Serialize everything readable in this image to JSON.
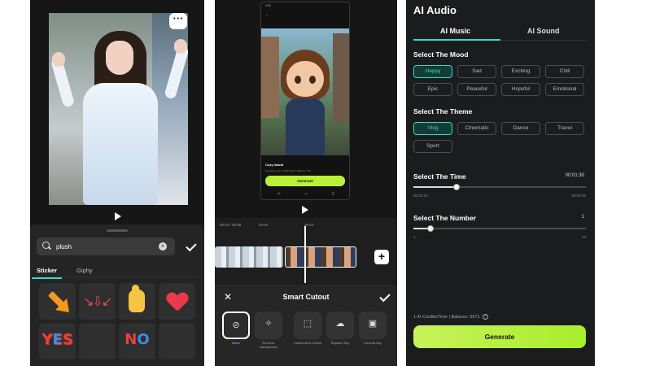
{
  "panel1": {
    "search": {
      "value": "plush",
      "clear_icon": "clear-icon"
    },
    "tabs": [
      "Sticker",
      "Giphy"
    ],
    "sticker_words": {
      "yes": "YES",
      "no": "NO"
    },
    "more_label": "···"
  },
  "panel2": {
    "phone": {
      "status": "4:56",
      "card_title": "Cozy Island",
      "card_sub": "Seedance Lite / 1024*1024 / Balance: 567",
      "generate": "Generate"
    },
    "timeline": {
      "t1": "00:04 / 00:08",
      "t2": "00:02",
      "t3": "00:04"
    },
    "sheet_title": "Smart Cutout",
    "tools": [
      {
        "label": "None"
      },
      {
        "label": "Remove Background"
      },
      {
        "label": "Customized Cutout"
      },
      {
        "label": "Replace Sky"
      },
      {
        "label": "Chroma Key"
      }
    ]
  },
  "panel3": {
    "title": "AI Audio",
    "tabs": [
      "AI Music",
      "AI Sound"
    ],
    "mood_title": "Select The Mood",
    "moods": [
      "Happy",
      "Sad",
      "Exciting",
      "Chill",
      "Epic",
      "Peaceful",
      "Hopeful",
      "Emotional"
    ],
    "selected_mood": "Happy",
    "theme_title": "Select The Theme",
    "themes": [
      "Vlog",
      "Cinematic",
      "Dance",
      "Travel",
      "Sport"
    ],
    "selected_theme": "Vlog",
    "time": {
      "label": "Select The Time",
      "value": "00:01:30",
      "min": "00:00:20",
      "max": "00:05:00",
      "fraction": 0.25
    },
    "number": {
      "label": "Select The Number",
      "value": "1",
      "min": "1",
      "max": "10",
      "fraction": 0.1
    },
    "credits": "1 AI Credits/Time | Balance: 5671",
    "generate": "Generate"
  },
  "colors": {
    "accent": "#2fe0c5",
    "generate": "#b8f03a"
  }
}
